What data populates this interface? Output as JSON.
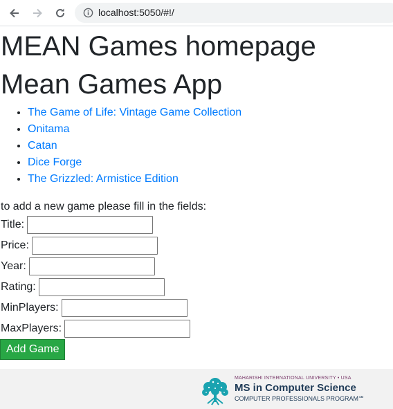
{
  "browser": {
    "url": "localhost:5050/#!/"
  },
  "page": {
    "title": "MEAN Games homepage",
    "app_title": "Mean Games App",
    "games": [
      "The Game of Life: Vintage Game Collection",
      "Onitama",
      "Catan",
      "Dice Forge",
      "The Grizzled: Armistice Edition"
    ],
    "form": {
      "intro": "to add a new game please fill in the fields:",
      "title_label": "Title:",
      "price_label": "Price:",
      "year_label": "Year:",
      "rating_label": "Rating:",
      "minplayers_label": "MinPlayers:",
      "maxplayers_label": "MaxPlayers:",
      "submit_label": "Add Game"
    }
  },
  "footer": {
    "logo_small": "MAHARISHI INTERNATIONAL UNIVERSITY • USA",
    "logo_main": "MS in Computer Science",
    "logo_sub": "COMPUTER PROFESSIONALS PROGRAM℠",
    "logo_color": "#1aa3b0"
  }
}
